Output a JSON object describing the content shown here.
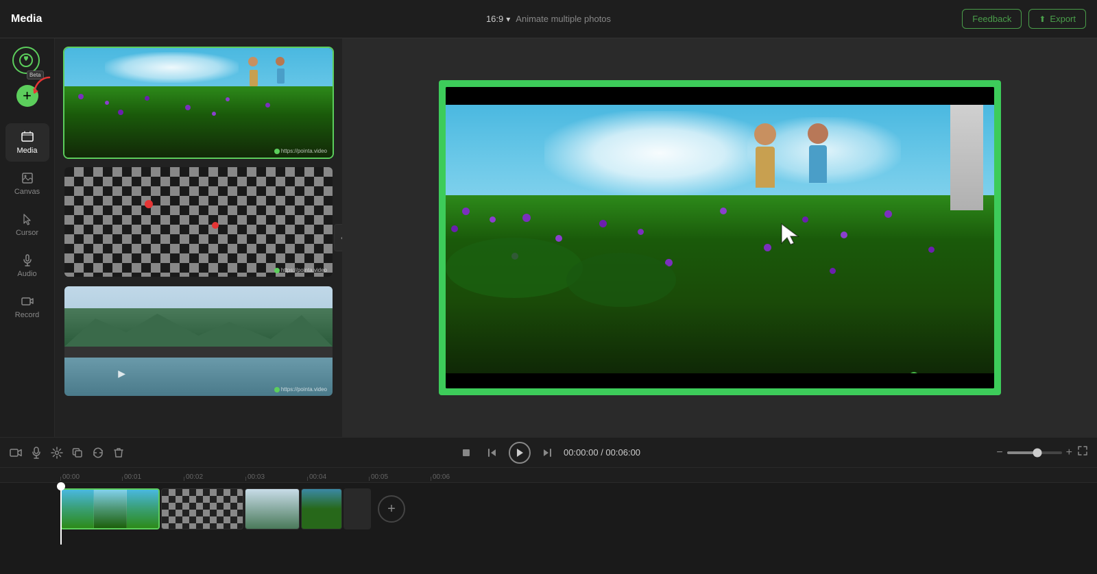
{
  "header": {
    "title": "Media",
    "aspect_ratio": "16:9",
    "aspect_ratio_label": "16:9",
    "subtitle": "Animate multiple photos",
    "feedback_label": "Feedback",
    "export_label": "Export"
  },
  "sidebar": {
    "logo_alt": "Pointa logo",
    "beta_label": "Beta",
    "add_label": "+",
    "nav_items": [
      {
        "id": "media",
        "label": "Media",
        "active": true
      },
      {
        "id": "canvas",
        "label": "Canvas",
        "active": false
      },
      {
        "id": "cursor",
        "label": "Cursor",
        "active": false
      },
      {
        "id": "audio",
        "label": "Audio",
        "active": false
      },
      {
        "id": "record",
        "label": "Record",
        "active": false
      }
    ]
  },
  "timeline": {
    "play_label": "▶",
    "stop_label": "■",
    "skip_back_label": "⏮",
    "skip_forward_label": "⏭",
    "current_time": "00:00:00",
    "total_time": "00:06:00",
    "time_separator": "/",
    "ruler_marks": [
      "00:00",
      "00:01",
      "00:02",
      "00:03",
      "00:04",
      "00:05",
      "00:06"
    ]
  },
  "watermark": {
    "url": "https://pointa.video"
  },
  "icons": {
    "video_camera": "🎬",
    "mic": "🎙",
    "scissors": "✂",
    "copy": "⊡",
    "refresh_clips": "↺",
    "trash": "🗑",
    "camera": "📷",
    "cursor_icon": "↖",
    "music": "♪",
    "rec": "⏺",
    "chevron_down": "▾",
    "upload": "⬆",
    "chevron_left": "‹"
  }
}
